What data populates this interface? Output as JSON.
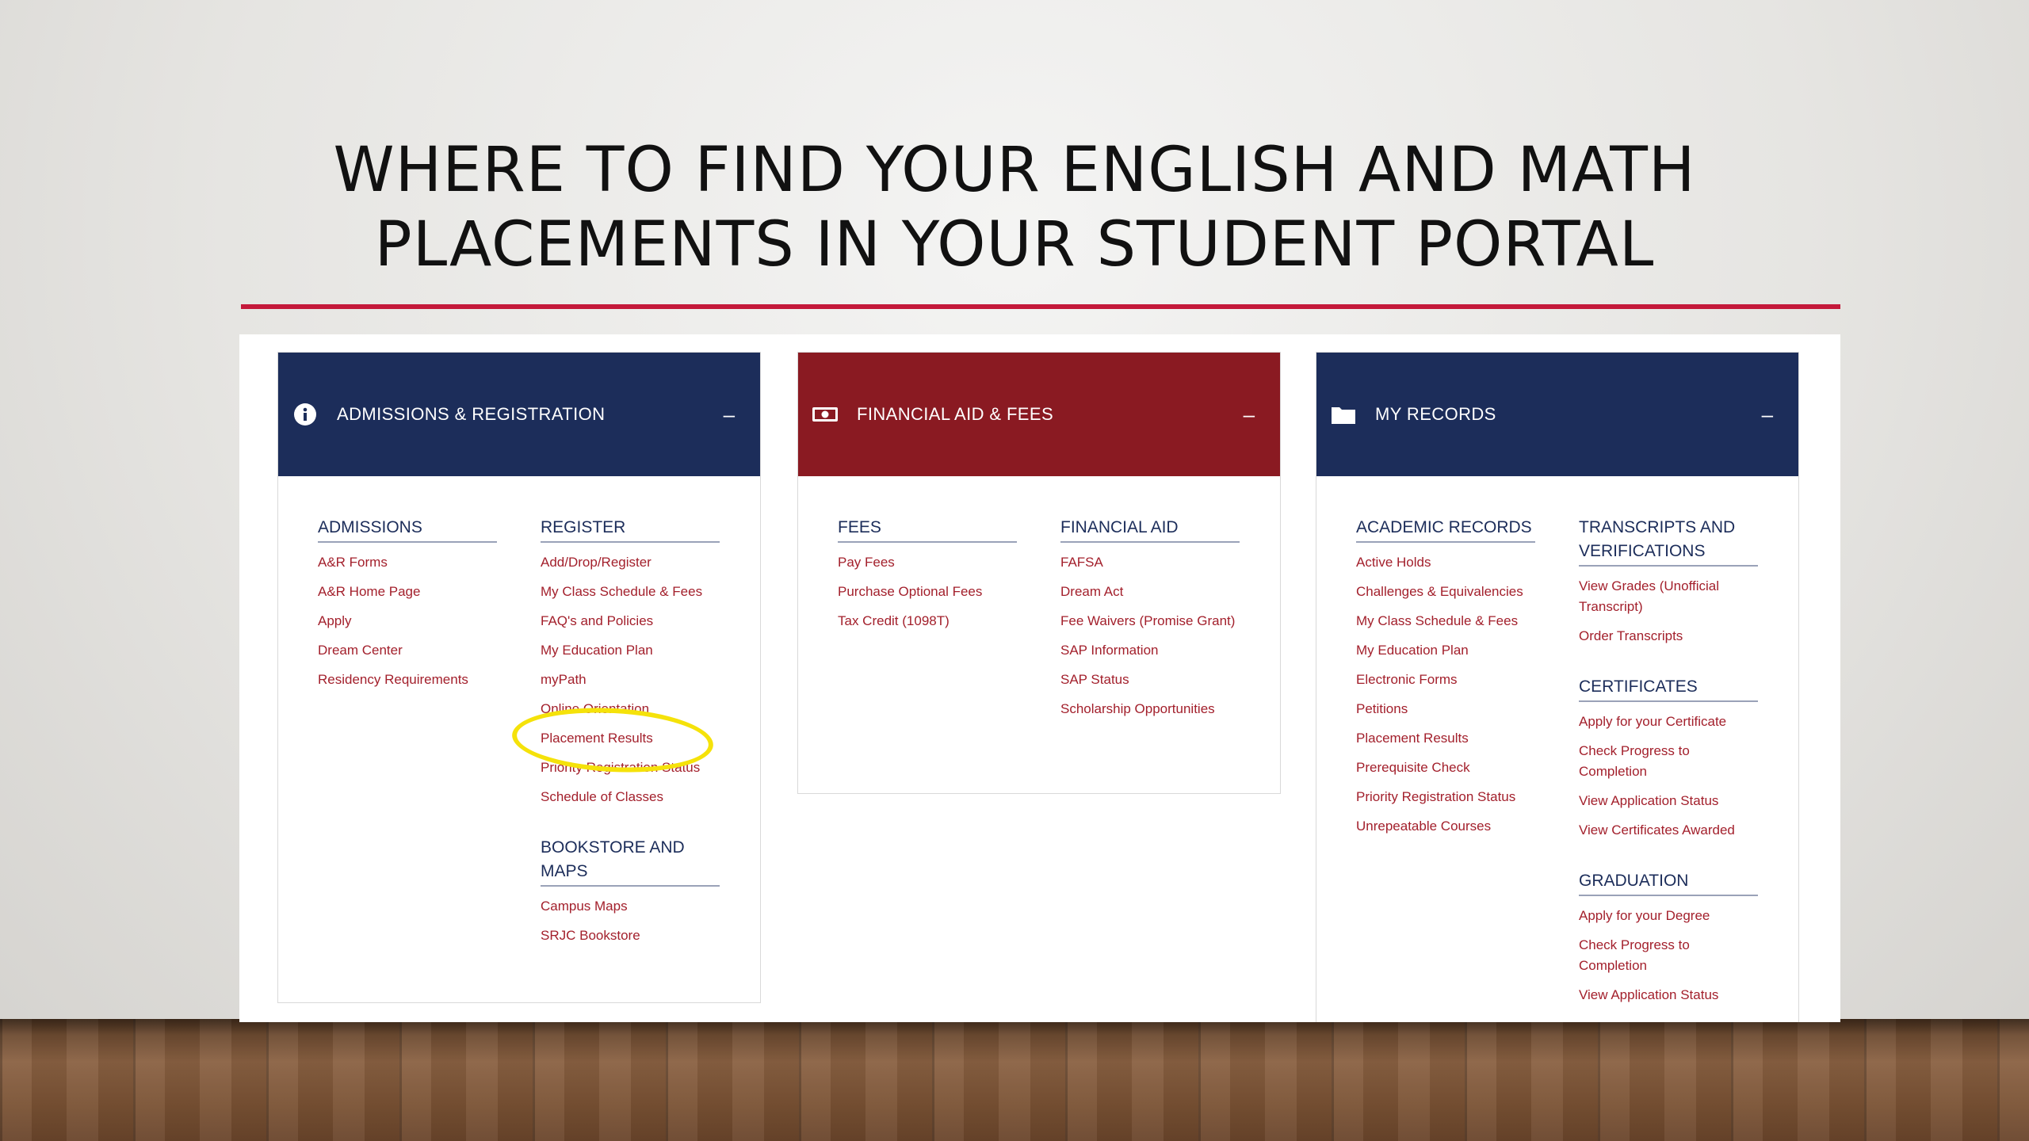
{
  "slide_title": [
    "WHERE TO FIND YOUR ENGLISH AND MATH",
    "PLACEMENTS IN YOUR STUDENT PORTAL"
  ],
  "colors": {
    "navy": "#1c2d5a",
    "crimson": "#8a1a22",
    "link": "#a3202c",
    "rule": "#c4193a",
    "highlight": "#f5e20a"
  },
  "panels": [
    {
      "title": "ADMISSIONS & REGISTRATION",
      "icon": "info-icon",
      "collapse": "–",
      "columns": [
        {
          "sections": [
            {
              "heading": "ADMISSIONS",
              "links": [
                "A&R Forms",
                "A&R Home Page",
                "Apply",
                "Dream Center",
                "Residency Requirements"
              ]
            }
          ]
        },
        {
          "sections": [
            {
              "heading": "REGISTER",
              "links": [
                "Add/Drop/Register",
                "My Class Schedule & Fees",
                "FAQ's and Policies",
                "My Education Plan",
                "myPath",
                "Online Orientation",
                "Placement Results",
                "Priority Registration Status",
                "Schedule of Classes"
              ]
            },
            {
              "heading": "BOOKSTORE AND MAPS",
              "links": [
                "Campus Maps",
                "SRJC Bookstore"
              ]
            }
          ]
        }
      ]
    },
    {
      "title": "FINANCIAL AID & FEES",
      "icon": "money-icon",
      "collapse": "–",
      "columns": [
        {
          "sections": [
            {
              "heading": "FEES",
              "links": [
                "Pay Fees",
                "Purchase Optional Fees",
                "Tax Credit (1098T)"
              ]
            }
          ]
        },
        {
          "sections": [
            {
              "heading": "FINANCIAL AID",
              "links": [
                "FAFSA",
                "Dream Act",
                "Fee Waivers (Promise Grant)",
                "SAP Information",
                "SAP Status",
                "Scholarship Opportunities"
              ]
            }
          ]
        }
      ]
    },
    {
      "title": "MY RECORDS",
      "icon": "folder-icon",
      "collapse": "–",
      "columns": [
        {
          "sections": [
            {
              "heading": "ACADEMIC RECORDS",
              "links": [
                "Active Holds",
                "Challenges & Equivalencies",
                "My Class Schedule & Fees",
                "My Education Plan",
                "Electronic Forms",
                "Petitions",
                "Placement Results",
                "Prerequisite Check",
                "Priority Registration Status",
                "Unrepeatable Courses"
              ]
            }
          ]
        },
        {
          "sections": [
            {
              "heading": "TRANSCRIPTS AND VERIFICATIONS",
              "links": [
                "View Grades (Unofficial Transcript)",
                "Order Transcripts"
              ]
            },
            {
              "heading": "CERTIFICATES",
              "links": [
                "Apply for your Certificate",
                "Check Progress to Completion",
                "View Application Status",
                "View Certificates Awarded"
              ]
            },
            {
              "heading": "GRADUATION",
              "links": [
                "Apply for your Degree",
                "Check Progress to Completion",
                "View Application Status"
              ]
            }
          ]
        }
      ]
    }
  ]
}
